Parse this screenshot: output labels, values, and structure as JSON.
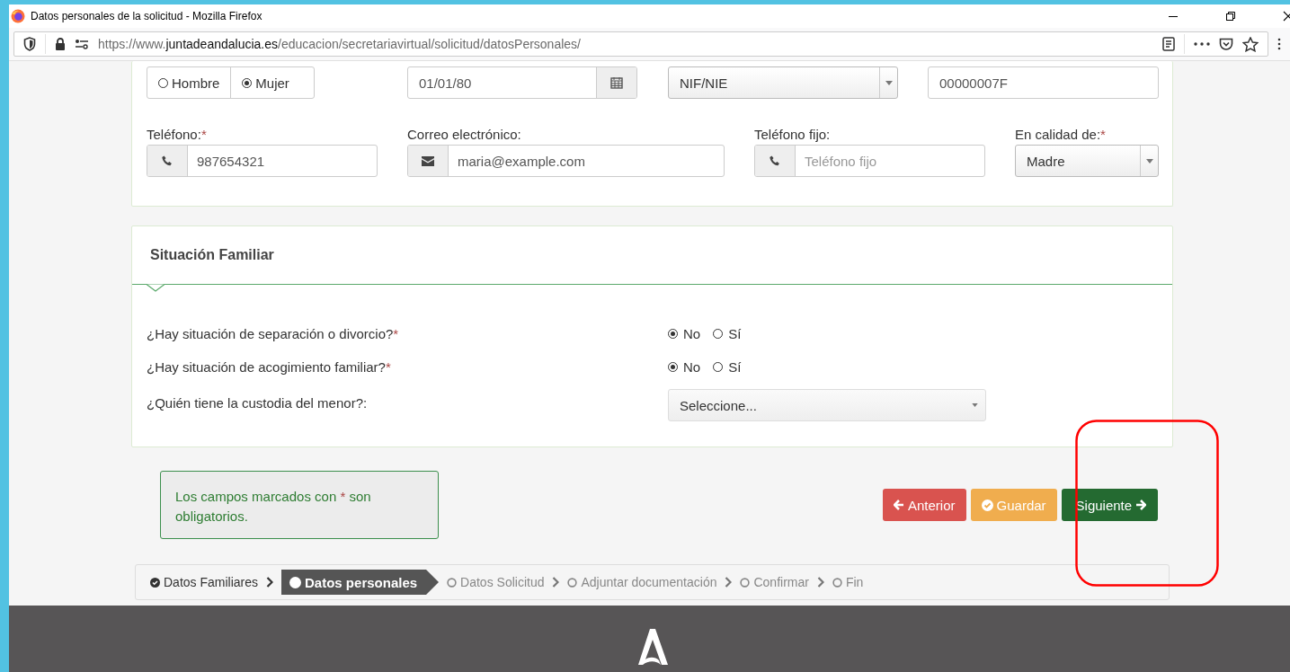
{
  "window": {
    "title": "Datos personales de la solicitud - Mozilla Firefox"
  },
  "address_bar": {
    "url_prefix": "https://www.",
    "url_domain": "juntadeandalucia.es",
    "url_path": "/educacion/secretariavirtual/solicitud/datosPersonales/"
  },
  "personal_data": {
    "gender_options": [
      {
        "label": "Hombre",
        "selected": false
      },
      {
        "label": "Mujer",
        "selected": true
      }
    ],
    "birth_date": "01/01/80",
    "document_type": "NIF/NIE",
    "document_number": "00000007F",
    "fields": [
      {
        "kind": "phone",
        "label": "Teléfono:",
        "required_mark": "*",
        "value": "987654321"
      },
      {
        "kind": "email",
        "label": "Correo electrónico:",
        "value": "maria@example.com"
      },
      {
        "kind": "phone",
        "label": "Teléfono fijo:",
        "placeholder": "Teléfono fijo"
      },
      {
        "kind": "select",
        "label": "En calidad de:",
        "required_mark": "*",
        "value": "Madre"
      }
    ]
  },
  "family_situation": {
    "title": "Situación Familiar",
    "questions": [
      {
        "kind": "yesno",
        "text": "¿Hay situación de separación o divorcio?",
        "required_mark": "*",
        "options": [
          {
            "label": "No",
            "selected": true
          },
          {
            "label": "Sí",
            "selected": false
          }
        ]
      },
      {
        "kind": "yesno",
        "text": "¿Hay situación de acogimiento familiar?",
        "required_mark": "*",
        "options": [
          {
            "label": "No",
            "selected": true
          },
          {
            "label": "Sí",
            "selected": false
          }
        ]
      },
      {
        "kind": "select",
        "text": "¿Quién tiene la custodia del menor?:",
        "value": "Seleccione..."
      }
    ]
  },
  "note": {
    "text_before": "Los campos marcados con",
    "mark": "*",
    "text_after": "son obligatorios."
  },
  "buttons": [
    {
      "kind": "back",
      "label": "Anterior"
    },
    {
      "kind": "save",
      "label": "Guardar"
    },
    {
      "kind": "next",
      "label": "Siguiente"
    }
  ],
  "steps": [
    {
      "label": "Datos Familiares",
      "completed": true,
      "selected": false
    },
    {
      "label": "Datos personales",
      "completed": false,
      "selected": true
    },
    {
      "label": "Datos Solicitud",
      "completed": false,
      "selected": false
    },
    {
      "label": "Adjuntar documentación",
      "completed": false,
      "selected": false
    },
    {
      "label": "Confirmar",
      "completed": false,
      "selected": false
    },
    {
      "label": "Fin",
      "completed": false,
      "selected": false
    }
  ]
}
